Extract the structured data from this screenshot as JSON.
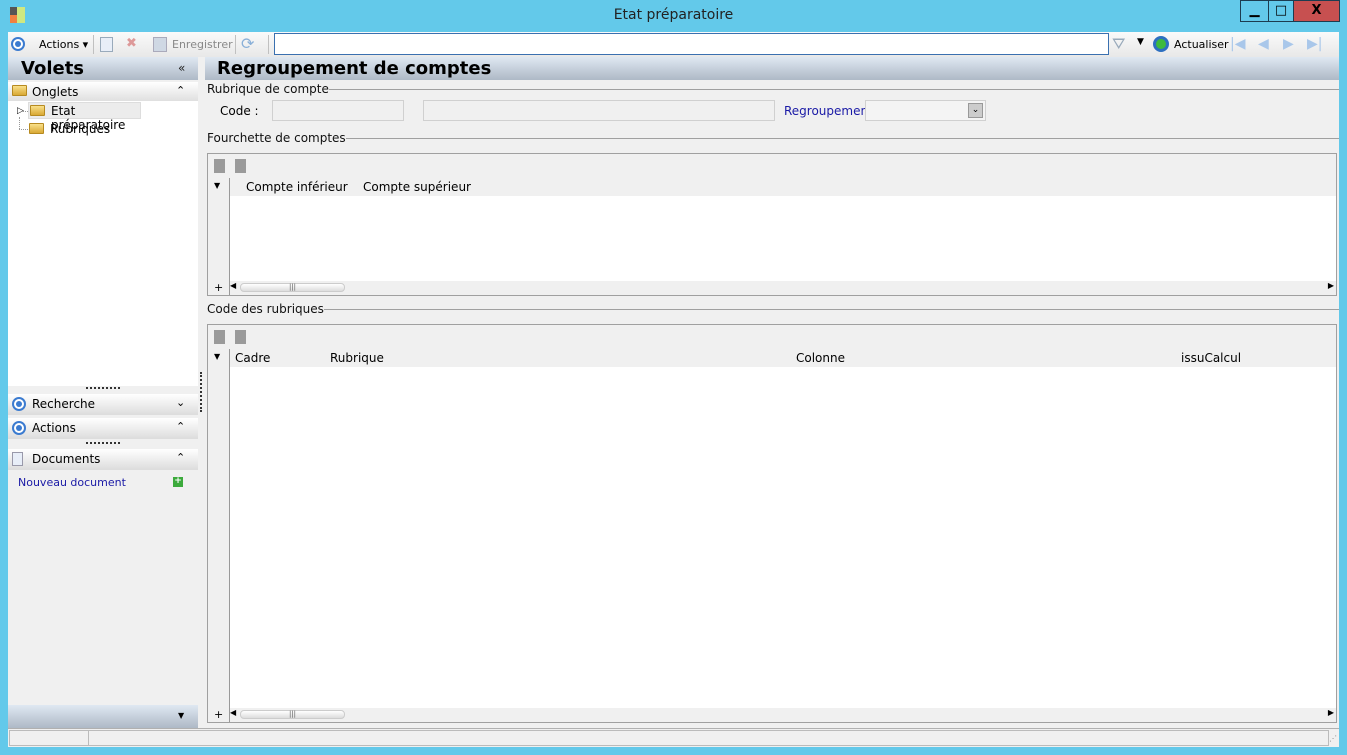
{
  "window": {
    "title": "Etat préparatoire",
    "minimize": "▁",
    "maximize": "□",
    "close": "X"
  },
  "toolbar": {
    "actions_label": "Actions",
    "save_label": "Enregistrer",
    "search_value": "",
    "refresh_label": "Actualiser"
  },
  "sidebar": {
    "title": "Volets",
    "onglets_label": "Onglets",
    "tree": [
      {
        "label": "Etat préparatoire",
        "selected": true
      },
      {
        "label": "Rubriques",
        "selected": false
      }
    ],
    "recherche_label": "Recherche",
    "actions_label": "Actions",
    "documents_label": "Documents",
    "new_document_label": "Nouveau document"
  },
  "main": {
    "title": "Regroupement de comptes",
    "rubrique": {
      "group_label": "Rubrique de compte",
      "code_label": "Code :",
      "code_value": "",
      "libelle_value": "",
      "regroupement_label": "Regroupement :",
      "regroupement_value": ""
    },
    "fourchette": {
      "group_label": "Fourchette de comptes",
      "columns": [
        "Compte inférieur",
        "Compte supérieur"
      ]
    },
    "code_rubriques": {
      "group_label": "Code des rubriques",
      "columns": [
        "Cadre",
        "Rubrique",
        "Colonne",
        "issuCalcul"
      ]
    }
  },
  "colors": {
    "frame": "#63c9ea",
    "link": "#1a1aa6",
    "close": "#c75050"
  }
}
